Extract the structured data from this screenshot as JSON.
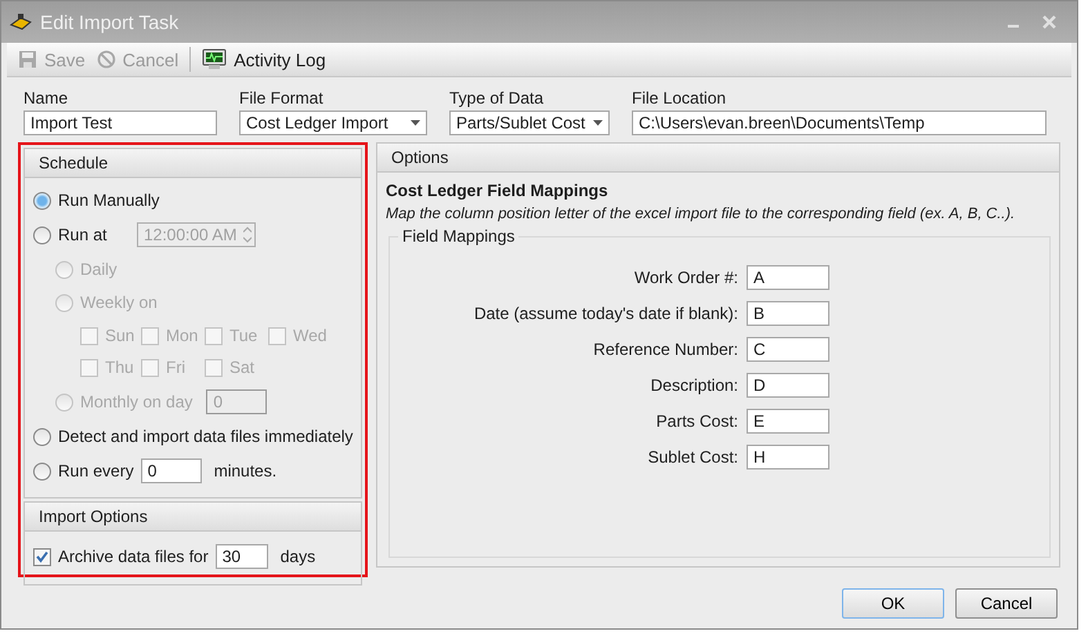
{
  "window": {
    "title": "Edit Import Task"
  },
  "toolbar": [
    {
      "kind": "save",
      "label": "Save",
      "disabled": true
    },
    {
      "kind": "cancel",
      "label": "Cancel",
      "disabled": true
    },
    {
      "kind": "log",
      "label": "Activity Log",
      "disabled": false
    }
  ],
  "fields": [
    {
      "kind": "text",
      "label": "Name",
      "value": "Import Test"
    },
    {
      "kind": "dropdown",
      "label": "File Format",
      "value": "Cost Ledger Import"
    },
    {
      "kind": "dropdown",
      "label": "Type of Data",
      "value": "Parts/Sublet Cost"
    },
    {
      "kind": "text",
      "label": "File Location",
      "value": "C:\\Users\\evan.breen\\Documents\\Temp"
    }
  ],
  "schedule": {
    "title": "Schedule",
    "items": [
      {
        "kind": "radio",
        "label": "Run Manually",
        "selected": true,
        "disabled": false
      },
      {
        "kind": "time",
        "label": "Run at",
        "selected": false,
        "disabled": false,
        "value": "12:00:00 AM",
        "field_disabled": true,
        "children": [
          {
            "kind": "radio",
            "label": "Daily",
            "selected": false,
            "disabled": true
          },
          {
            "kind": "days",
            "label": "Weekly on",
            "selected": false,
            "disabled": true,
            "days": [
              {
                "label": "Sun",
                "checked": false
              },
              {
                "label": "Mon",
                "checked": false
              },
              {
                "label": "Tue",
                "checked": false
              },
              {
                "label": "Wed",
                "checked": false
              },
              {
                "label": "Thu",
                "checked": false
              },
              {
                "label": "Fri",
                "checked": false
              },
              {
                "label": "Sat",
                "checked": false
              }
            ]
          },
          {
            "kind": "number",
            "label": "Monthly on day",
            "selected": false,
            "disabled": true,
            "value": "0"
          }
        ]
      },
      {
        "kind": "radio",
        "label": "Detect and import data files immediately",
        "selected": false,
        "disabled": false
      },
      {
        "kind": "number",
        "label": "Run every",
        "selected": false,
        "disabled": false,
        "value": "0",
        "suffix": "minutes."
      }
    ]
  },
  "import_options": {
    "title": "Import Options",
    "archive": {
      "label": "Archive data files for",
      "checked": true,
      "value": "30",
      "suffix": "days"
    }
  },
  "options": {
    "title": "Options",
    "heading": "Cost Ledger Field Mappings",
    "hint": "Map the column position letter of the excel import file to the corresponding field (ex. A, B, C..).",
    "group": "Field Mappings",
    "mappings": [
      {
        "label": "Work Order #:",
        "value": "A"
      },
      {
        "label": "Date (assume today's date if blank):",
        "value": "B"
      },
      {
        "label": "Reference Number:",
        "value": "C"
      },
      {
        "label": "Description:",
        "value": "D"
      },
      {
        "label": "Parts Cost:",
        "value": "E"
      },
      {
        "label": "Sublet Cost:",
        "value": "H"
      }
    ]
  },
  "buttons": [
    {
      "label": "OK",
      "default": true
    },
    {
      "label": "Cancel",
      "default": false
    }
  ]
}
